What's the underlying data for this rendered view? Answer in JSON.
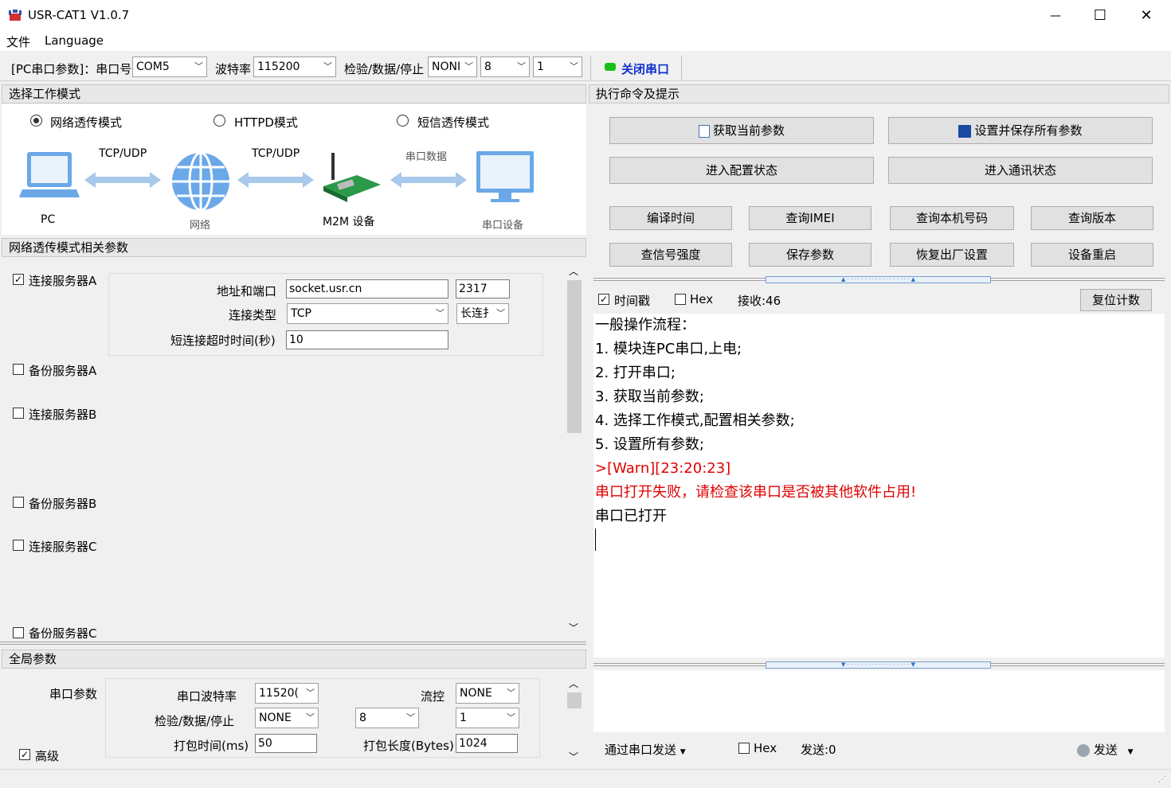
{
  "window": {
    "title": "USR-CAT1 V1.0.7",
    "min": "—",
    "max": "☐",
    "close": "✕"
  },
  "menu": [
    "文件",
    "Language"
  ],
  "toolbar": {
    "prefix": "[PC串口参数]：串口号",
    "port": "COM5",
    "baud_label": "波特率",
    "baud": "115200",
    "parity_label": "检验/数据/停止",
    "parity": "NONI",
    "data_bits": "8",
    "stop_bits": "1",
    "toggle": "关闭串口"
  },
  "mode": {
    "section": "选择工作模式",
    "radios": [
      "网络透传模式",
      "HTTPD模式",
      "短信透传模式"
    ],
    "selected": 0,
    "diagram": {
      "pc": "PC",
      "proto1": "TCP/UDP",
      "net": "网络",
      "proto2": "TCP/UDP",
      "m2m": "M2M 设备",
      "serial_data": "串口数据",
      "serial_dev": "串口设备"
    }
  },
  "net_params": {
    "section": "网络透传模式相关参数",
    "items": [
      {
        "label": "连接服务器A",
        "checked": true
      },
      {
        "label": "备份服务器A",
        "checked": false
      },
      {
        "label": "连接服务器B",
        "checked": false
      },
      {
        "label": "备份服务器B",
        "checked": false
      },
      {
        "label": "连接服务器C",
        "checked": false
      },
      {
        "label": "备份服务器C",
        "checked": false
      }
    ],
    "addr_label": "地址和端口",
    "addr": "socket.usr.cn",
    "port": "2317",
    "type_label": "连接类型",
    "type": "TCP",
    "conn_mode": "长连扌",
    "timeout_label": "短连接超时时间(秒)",
    "timeout": "10"
  },
  "global": {
    "section": "全局参数",
    "serial_params": "串口参数",
    "baud_label": "串口波特率",
    "baud": "11520(",
    "flow_label": "流控",
    "flow": "NONE",
    "parity_label": "检验/数据/停止",
    "parity": "NONE",
    "data_bits": "8",
    "stop_bits": "1",
    "pack_time_label": "打包时间(ms)",
    "pack_time": "50",
    "pack_len_label": "打包长度(Bytes)",
    "pack_len": "1024",
    "advanced": "高级"
  },
  "cmd": {
    "section": "执行命令及提示",
    "get_params": "获取当前参数",
    "save_all": "设置并保存所有参数",
    "enter_config": "进入配置状态",
    "enter_comm": "进入通讯状态",
    "row3": [
      "编译时间",
      "查询IMEI",
      "查询本机号码",
      "查询版本"
    ],
    "row4": [
      "查信号强度",
      "保存参数",
      "恢复出厂设置",
      "设备重启"
    ]
  },
  "recv": {
    "timestamp": "时间戳",
    "hex": "Hex",
    "count": "接收:46",
    "reset": "复位计数",
    "lines": [
      {
        "text": "一般操作流程：",
        "color": "#000000"
      },
      {
        "text": "1. 模块连PC串口,上电;",
        "color": "#000000"
      },
      {
        "text": "2. 打开串口;",
        "color": "#000000"
      },
      {
        "text": "3. 获取当前参数;",
        "color": "#000000"
      },
      {
        "text": "4. 选择工作模式,配置相关参数;",
        "color": "#000000"
      },
      {
        "text": "5. 设置所有参数;",
        "color": "#000000"
      },
      {
        "text": ">[Warn][23:20:23]",
        "color": "#e00000"
      },
      {
        "text": "串口打开失败，请检查该串口是否被其他软件占用!",
        "color": "#e00000"
      },
      {
        "text": "串口已打开",
        "color": "#000000"
      }
    ]
  },
  "send": {
    "via": "通过串口发送",
    "hex": "Hex",
    "count": "发送:0",
    "send": "发送"
  }
}
